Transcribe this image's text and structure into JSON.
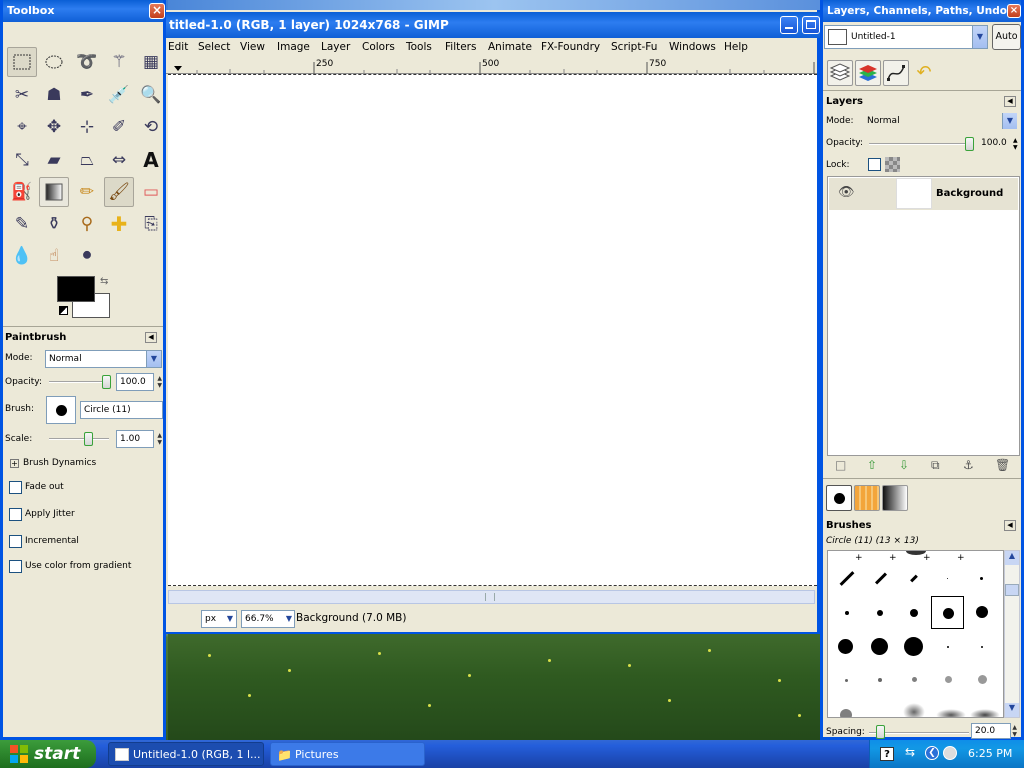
{
  "toolbox": {
    "title": "Toolbox",
    "tool_options_title": "Paintbrush",
    "mode_label": "Mode:",
    "mode_value": "Normal",
    "opacity_label": "Opacity:",
    "opacity_value": "100.0",
    "brush_label": "Brush:",
    "brush_value": "Circle (11)",
    "scale_label": "Scale:",
    "scale_value": "1.00",
    "brush_dynamics": "Brush Dynamics",
    "fade_out": "Fade out",
    "apply_jitter": "Apply Jitter",
    "incremental": "Incremental",
    "use_color_gradient": "Use color from gradient",
    "fg_color": "#000000",
    "bg_color": "#ffffff"
  },
  "image_window": {
    "title": "titled-1.0 (RGB, 1 layer) 1024x768 - GIMP",
    "menu": [
      "Edit",
      "Select",
      "View",
      "Image",
      "Layer",
      "Colors",
      "Tools",
      "Filters",
      "Animate",
      "FX-Foundry",
      "Script-Fu",
      "Windows",
      "Help"
    ],
    "ruler_ticks": [
      "250",
      "500",
      "750"
    ],
    "unit": "px",
    "zoom": "66.7%",
    "status": "Background (7.0 MB)"
  },
  "dock": {
    "title": "Layers, Channels, Paths, Undo -...",
    "image_select": "Untitled-1",
    "auto_button": "Auto",
    "layers_title": "Layers",
    "mode_label": "Mode:",
    "mode_value": "Normal",
    "opacity_label": "Opacity:",
    "opacity_value": "100.0",
    "lock_label": "Lock:",
    "layer_name": "Background",
    "brushes_title": "Brushes",
    "brush_current": "Circle (11) (13 × 13)",
    "spacing_label": "Spacing:",
    "spacing_value": "20.0"
  },
  "taskbar": {
    "start": "start",
    "tasks": [
      "Untitled-1.0 (RGB, 1 l...",
      "Pictures"
    ],
    "time": "6:25 PM"
  }
}
